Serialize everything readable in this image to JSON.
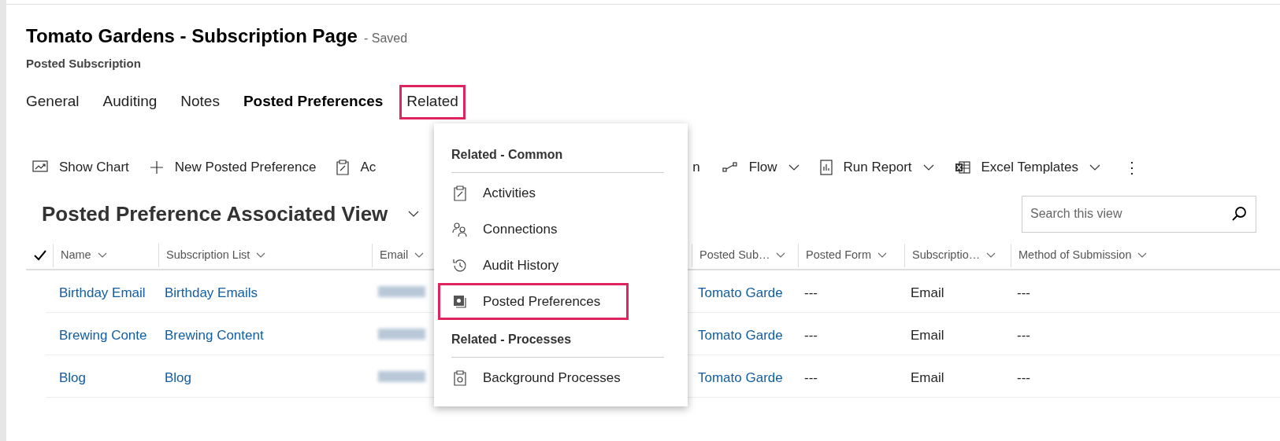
{
  "header": {
    "title": "Tomato Gardens - Subscription Page",
    "status": "- Saved",
    "entity": "Posted Subscription"
  },
  "tabs": [
    {
      "label": "General",
      "selected": false,
      "highlighted": false
    },
    {
      "label": "Auditing",
      "selected": false,
      "highlighted": false
    },
    {
      "label": "Notes",
      "selected": false,
      "highlighted": false
    },
    {
      "label": "Posted Preferences",
      "selected": true,
      "highlighted": false
    },
    {
      "label": "Related",
      "selected": false,
      "highlighted": true
    }
  ],
  "toolbar": [
    {
      "kind": "chart",
      "label": "Show Chart",
      "dropdown": false
    },
    {
      "kind": "plus",
      "label": "New Posted Preference",
      "dropdown": false
    },
    {
      "kind": "activity",
      "label": "Ac",
      "dropdown": false
    },
    {
      "kind": "fragment",
      "label": "n"
    },
    {
      "kind": "flow",
      "label": "Flow",
      "dropdown": true
    },
    {
      "kind": "report",
      "label": "Run Report",
      "dropdown": true
    },
    {
      "kind": "excel",
      "label": "Excel Templates",
      "dropdown": true
    },
    {
      "kind": "more",
      "label": "⋮"
    }
  ],
  "view": {
    "title": "Posted Preference Associated View",
    "search_placeholder": "Search this view"
  },
  "table": {
    "columns": [
      "Name",
      "Subscription List",
      "Email",
      "Posted Sub…",
      "Posted Form",
      "Subscriptio…",
      "Method of Submission"
    ],
    "rows": [
      [
        "Birthday Email",
        "Birthday Emails",
        "",
        "Tomato Garde",
        "---",
        "Email",
        "---"
      ],
      [
        "Brewing Conte",
        "Brewing Content",
        "",
        "Tomato Garde",
        "---",
        "Email",
        "---"
      ],
      [
        "Blog",
        "Blog",
        "",
        "Tomato Garde",
        "---",
        "Email",
        "---"
      ]
    ]
  },
  "related_menu": {
    "sections": [
      {
        "heading": "Related - Common",
        "items": [
          {
            "kind": "activities",
            "label": "Activities",
            "highlighted": false
          },
          {
            "kind": "connections",
            "label": "Connections",
            "highlighted": false
          },
          {
            "kind": "history",
            "label": "Audit History",
            "highlighted": false
          },
          {
            "kind": "preferences",
            "label": "Posted Preferences",
            "highlighted": true
          }
        ]
      },
      {
        "heading": "Related - Processes",
        "items": [
          {
            "kind": "processes",
            "label": "Background Processes",
            "highlighted": false
          }
        ]
      }
    ]
  }
}
